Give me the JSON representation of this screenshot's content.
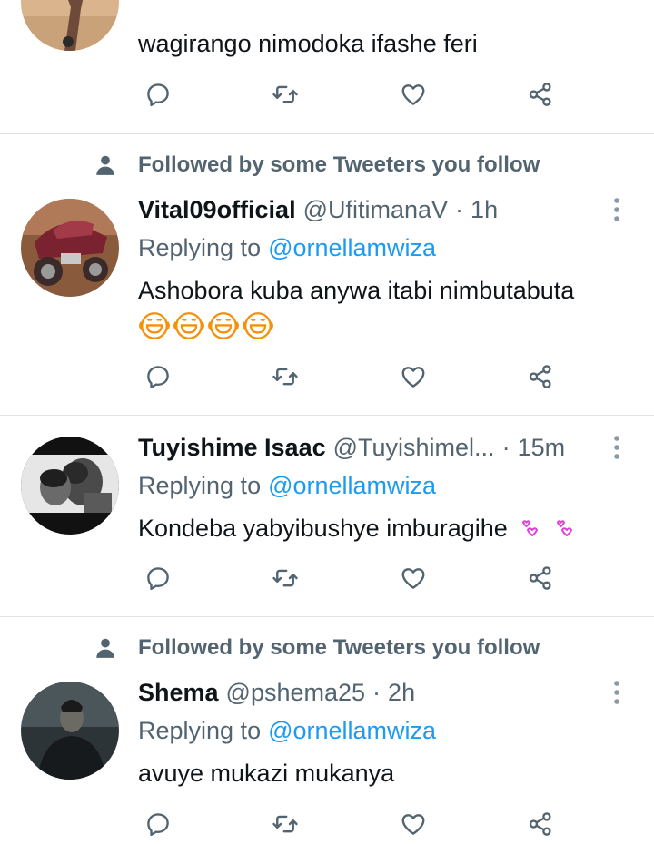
{
  "tweets": [
    {
      "text": "wagirango nimodoka ifashe feri"
    },
    {
      "social": "Followed by some Tweeters you follow",
      "name": "Vital09official",
      "handle": "@UfitimanaV",
      "separator": "·",
      "time": "1h",
      "reply_prefix": "Replying to",
      "mention": "@ornellamwiza",
      "text": "Ashobora kuba anywa itabi nimbutabuta",
      "emojis": "😂😂😂😂"
    },
    {
      "name": "Tuyishime Isaac",
      "handle": "@Tuyishimel...",
      "separator": "·",
      "time": "15m",
      "reply_prefix": "Replying to",
      "mention": "@ornellamwiza",
      "text": "Kondeba yabyibushye imburagihe",
      "emojis": "💞💞"
    },
    {
      "social": "Followed by some Tweeters you follow",
      "name": "Shema",
      "handle": "@pshema25",
      "separator": "·",
      "time": "2h",
      "reply_prefix": "Replying to",
      "mention": "@ornellamwiza",
      "text": "avuye mukazi mukanya"
    }
  ],
  "icons": {
    "reply": "reply-icon",
    "retweet": "retweet-icon",
    "like": "heart-icon",
    "share": "share-icon",
    "more": "more-dots-icon",
    "person": "person-icon"
  },
  "colors": {
    "accent": "#1d9bf0",
    "secondary_text": "#536471",
    "divider": "#dfe3e6",
    "emoji_orange": "#f4900c",
    "emoji_pink": "#e040d8"
  }
}
